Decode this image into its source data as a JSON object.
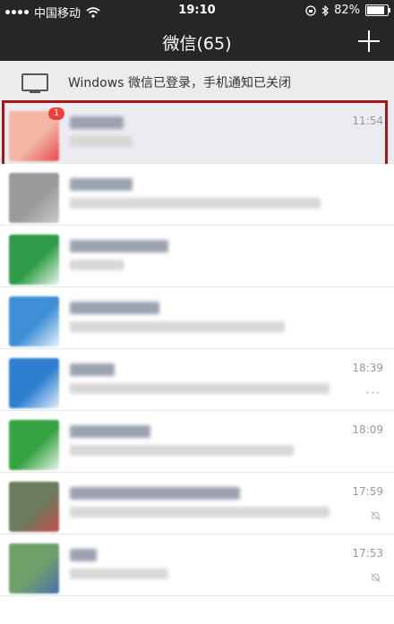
{
  "status_bar": {
    "carrier": "中国移动",
    "time": "19:10",
    "battery": "82%",
    "battery_level": 0.82
  },
  "nav": {
    "title": "微信(65)"
  },
  "notice": {
    "text": "Windows 微信已登录，手机通知已关闭"
  },
  "chats": [
    {
      "time": "11:54",
      "badge": "1",
      "avatar_color": "#f3b7a5",
      "accent": "#e84b4b",
      "name_width": 60,
      "msg_width": 70,
      "selected": true,
      "highlight": true,
      "muted": false,
      "more": false
    },
    {
      "time": "",
      "badge": "",
      "avatar_color": "#9a9a9a",
      "accent": "#c8c8c8",
      "name_width": 70,
      "msg_width": 280,
      "selected": false,
      "highlight": false,
      "muted": false,
      "more": false
    },
    {
      "time": "",
      "badge": "",
      "avatar_color": "#2e9b48",
      "accent": "#e9f6ea",
      "name_width": 110,
      "msg_width": 60,
      "selected": false,
      "highlight": false,
      "muted": false,
      "more": false
    },
    {
      "time": "",
      "badge": "",
      "avatar_color": "#3f8fd6",
      "accent": "#e8f1fb",
      "name_width": 100,
      "msg_width": 240,
      "selected": false,
      "highlight": false,
      "muted": false,
      "more": false
    },
    {
      "time": "18:39",
      "badge": "",
      "avatar_color": "#2f7fd0",
      "accent": "#e3eefa",
      "name_width": 50,
      "msg_width": 290,
      "selected": false,
      "highlight": false,
      "muted": false,
      "more": true
    },
    {
      "time": "18:09",
      "badge": "",
      "avatar_color": "#35a341",
      "accent": "#ebf6ea",
      "name_width": 90,
      "msg_width": 250,
      "selected": false,
      "highlight": false,
      "muted": false,
      "more": false
    },
    {
      "time": "17:59",
      "badge": "",
      "avatar_color": "#6a7b5e",
      "accent": "#c94c4c",
      "name_width": 190,
      "msg_width": 290,
      "selected": false,
      "highlight": false,
      "muted": true,
      "more": false
    },
    {
      "time": "17:53",
      "badge": "",
      "avatar_color": "#6fa06a",
      "accent": "#4a6fae",
      "name_width": 30,
      "msg_width": 110,
      "selected": false,
      "highlight": false,
      "muted": true,
      "more": false
    }
  ]
}
